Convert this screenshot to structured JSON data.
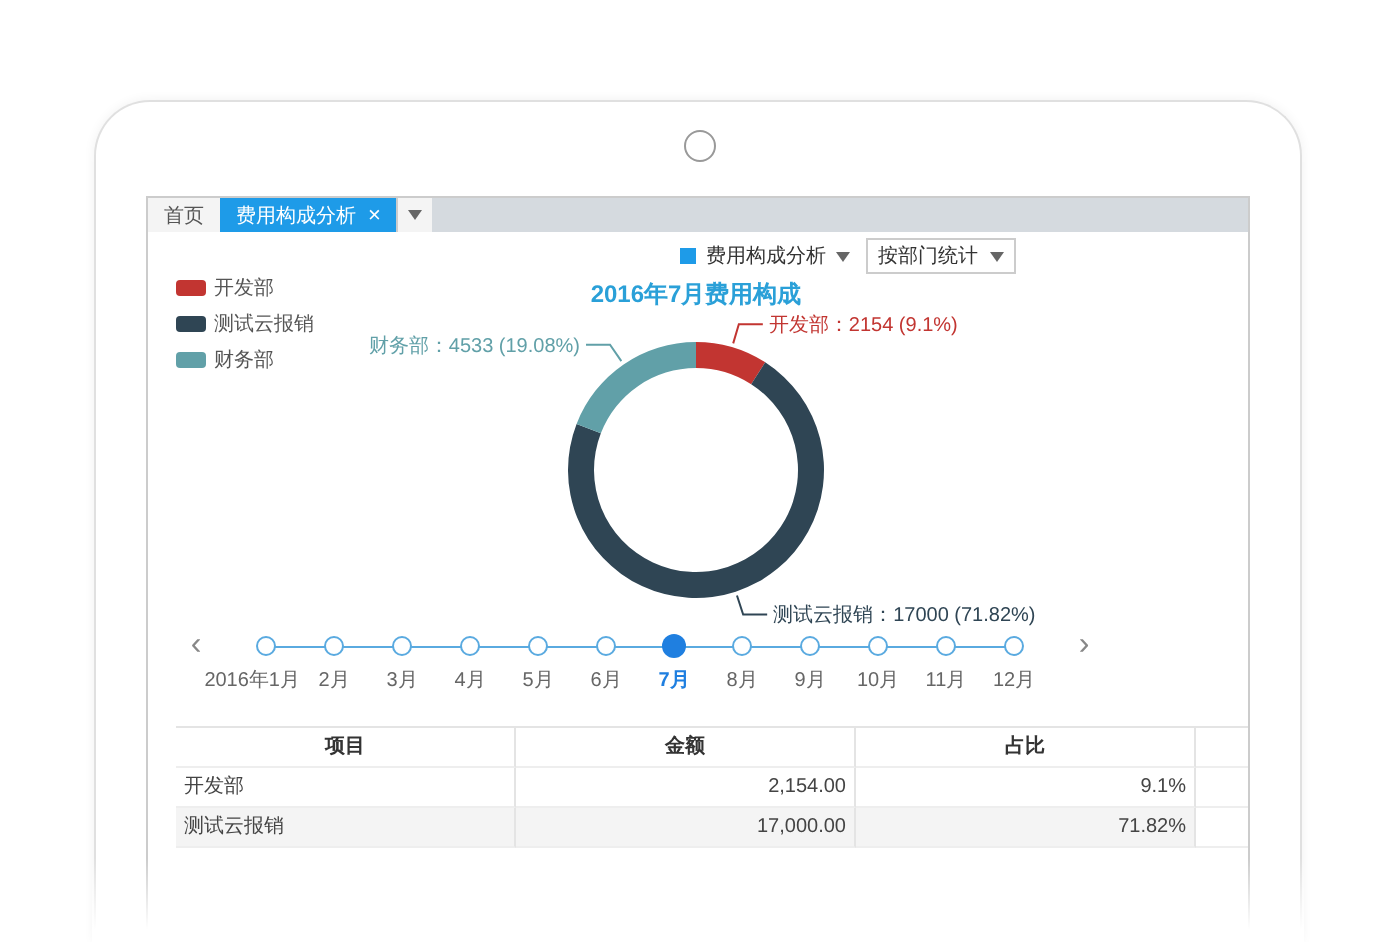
{
  "tabs": [
    {
      "label": "首页",
      "selected": false
    },
    {
      "label": "费用构成分析",
      "selected": true,
      "close": "×"
    }
  ],
  "toolbar": {
    "view": "费用构成分析",
    "group_by": "按部门统计"
  },
  "legend": [
    {
      "color": "#c23531"
    },
    {
      "color": "#2f4554"
    },
    {
      "color": "#61a0a8"
    }
  ],
  "chart_data": {
    "type": "donut",
    "title": "2016年7月费用构成",
    "categories": [
      "开发部",
      "测试云报销",
      "财务部"
    ],
    "values": [
      2154,
      17000,
      4533
    ],
    "value_labels": [
      "开发部：2154 (9.1%)",
      "测试云报销：17000 (71.82%)",
      "财务部：4533 (19.08%)"
    ]
  },
  "timeline": {
    "prev": "‹",
    "next": "›",
    "months": [
      {
        "label": "2016年1月",
        "selected": false
      },
      {
        "label": "2月",
        "selected": false
      },
      {
        "label": "3月",
        "selected": false
      },
      {
        "label": "4月",
        "selected": false
      },
      {
        "label": "5月",
        "selected": false
      },
      {
        "label": "6月",
        "selected": false
      },
      {
        "label": "7月",
        "selected": true
      },
      {
        "label": "8月",
        "selected": false
      },
      {
        "label": "9月",
        "selected": false
      },
      {
        "label": "10月",
        "selected": false
      },
      {
        "label": "11月",
        "selected": false
      },
      {
        "label": "12月",
        "selected": false
      }
    ]
  },
  "table": {
    "columns": [
      "项目",
      "金额",
      "占比"
    ],
    "rows": [
      [
        "开发部",
        "2,154.00",
        "9.1%"
      ],
      [
        "测试云报销",
        "17,000.00",
        "71.82%"
      ]
    ]
  }
}
